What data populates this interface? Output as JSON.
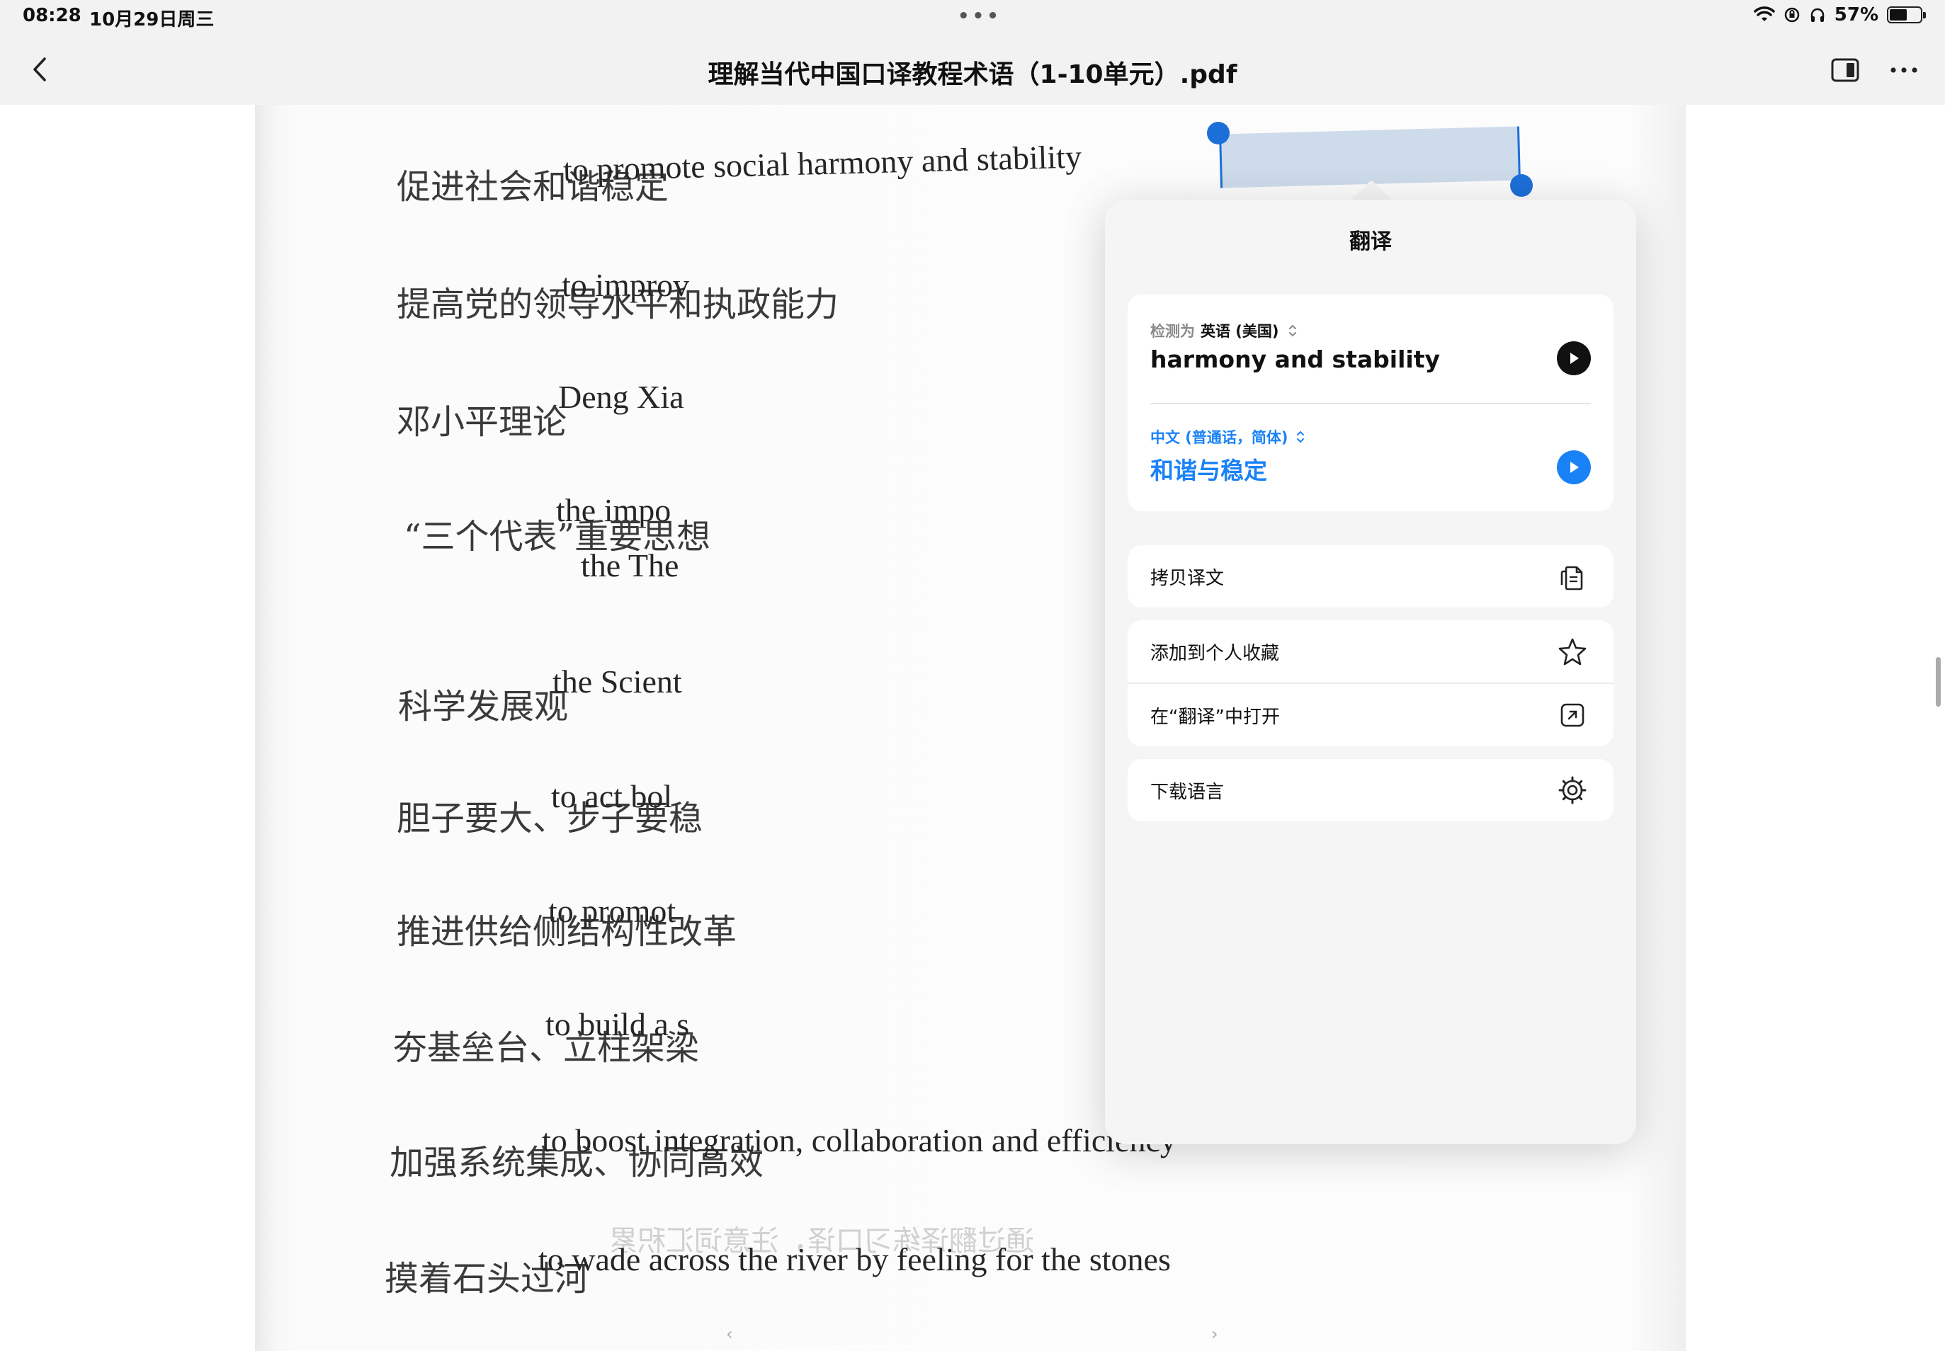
{
  "status_bar": {
    "time": "08:28",
    "date": "10月29日周三",
    "battery": "57%",
    "battery_level": 0.57,
    "icons": [
      "wifi-icon",
      "orientation-lock-icon",
      "headphones-icon",
      "battery-icon"
    ]
  },
  "nav": {
    "title": "理解当代中国口译教程术语（1-10单元）.pdf",
    "back_icon": "chevron-left-icon",
    "sidebar_icon": "sidebar-toggle-icon",
    "more_icon": "more-icon"
  },
  "document": {
    "rows": [
      {
        "zh": "促进社会和谐稳定",
        "en": "to promote social harmony and stability"
      },
      {
        "zh": "提高党的领导水平和执政能力",
        "en": "to improv"
      },
      {
        "zh": "邓小平理论",
        "en": "Deng Xia"
      },
      {
        "zh": "“三个代表”重要思想",
        "en": "the impo",
        "en2": "the The"
      },
      {
        "zh": "科学发展观",
        "en": "the Scient"
      },
      {
        "zh": "胆子要大、步子要稳",
        "en": "to act bol"
      },
      {
        "zh": "推进供给侧结构性改革",
        "en": "to promot"
      },
      {
        "zh": "夯基垒台、立柱架梁",
        "en": "to build a s"
      },
      {
        "zh": "加强系统集成、协同高效",
        "en": "to boost integration, collaboration and efficiency"
      },
      {
        "zh": "摸着石头过河",
        "en": "to wade across the river by feeling for the stones"
      }
    ],
    "selected_text": "harmony and stability"
  },
  "translate_popover": {
    "title": "翻译",
    "detect_prefix": "检测为",
    "source_lang": "英语 (美国)",
    "source_text": "harmony and stability",
    "target_lang": "中文 (普通话，简体)",
    "target_text": "和谐与稳定",
    "actions": {
      "copy": "拷贝译文",
      "favorite": "添加到个人收藏",
      "open_in_translate": "在“翻译”中打开",
      "download_languages": "下载语言"
    },
    "accent_color": "#1a82f7"
  }
}
